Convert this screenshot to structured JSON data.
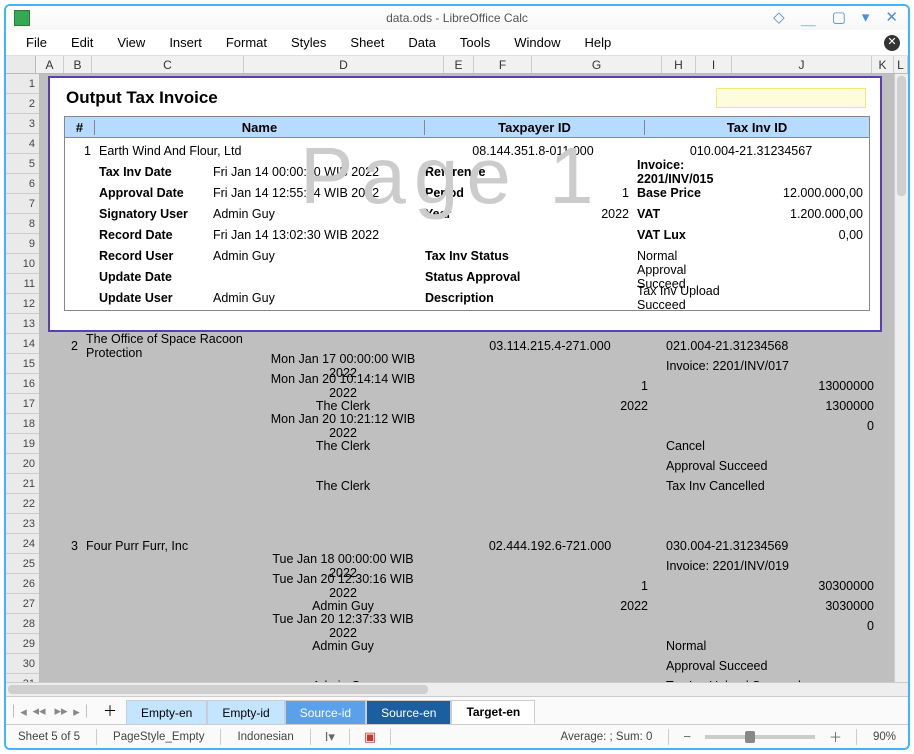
{
  "titlebar": {
    "title": "data.ods - LibreOffice Calc"
  },
  "menubar": {
    "items": [
      "File",
      "Edit",
      "View",
      "Insert",
      "Format",
      "Styles",
      "Sheet",
      "Data",
      "Tools",
      "Window",
      "Help"
    ]
  },
  "columns": [
    "A",
    "B",
    "C",
    "D",
    "E",
    "F",
    "G",
    "H",
    "I",
    "J",
    "K",
    "L"
  ],
  "row_start": 1,
  "row_end": 33,
  "watermark": "Page 1",
  "page": {
    "title": "Output Tax Invoice",
    "headers": {
      "num": "#",
      "name": "Name",
      "tpid": "Taxpayer ID",
      "inv": "Tax Inv ID"
    },
    "num": "1",
    "name": "Earth Wind And Flour, Ltd",
    "tpid": "08.144.351.8-011.000",
    "invid": "010.004-21.31234567",
    "rows": [
      {
        "label": "Tax Inv Date",
        "value": "Fri Jan 14 00:00:00 WIB 2022",
        "rlabel": "Reference",
        "rvalue": "",
        "xlabel": "Invoice: 2201/INV/015",
        "xvalue": ""
      },
      {
        "label": "Approval Date",
        "value": "Fri Jan 14 12:55:44 WIB 2022",
        "rlabel": "Period",
        "rvalue": "1",
        "xlabel": "Base Price",
        "xvalue": "12.000.000,00"
      },
      {
        "label": "Signatory User",
        "value": "Admin Guy",
        "rlabel": "Year",
        "rvalue": "2022",
        "xlabel": "VAT",
        "xvalue": "1.200.000,00"
      },
      {
        "label": "Record Date",
        "value": "Fri Jan 14 13:02:30 WIB 2022",
        "rlabel": "",
        "rvalue": "",
        "xlabel": "VAT Lux",
        "xvalue": "0,00"
      },
      {
        "label": "Record User",
        "value": "Admin Guy",
        "rlabel": "Tax Inv Status",
        "rvalue": "",
        "xlabel": "Normal",
        "xvalue": "",
        "xplain": true
      },
      {
        "label": "Update Date",
        "value": "",
        "rlabel": "Status Approval",
        "rvalue": "",
        "xlabel": "Approval Succeed",
        "xvalue": "",
        "xplain": true
      },
      {
        "label": "Update User",
        "value": "Admin Guy",
        "rlabel": "Description",
        "rvalue": "",
        "xlabel": "Tax Inv Upload Succeed",
        "xvalue": "",
        "xplain": true
      }
    ]
  },
  "below": [
    {
      "num": "2",
      "name": "The Office of Space Racoon Protection",
      "d": "",
      "tpid": "03.114.215.4-271.000",
      "inv": "021.004-21.31234568"
    },
    {
      "num": "",
      "name": "",
      "d": "Mon Jan 17 00:00:00 WIB 2022",
      "tpid": "",
      "inv": "Invoice: 2201/INV/017"
    },
    {
      "num": "",
      "name": "",
      "d": "Mon Jan 20 10:14:14 WIB 2022",
      "tpid_r": "1",
      "inv_r": "13000000"
    },
    {
      "num": "",
      "name": "",
      "d": "The Clerk",
      "tpid_r": "2022",
      "inv_r": "1300000"
    },
    {
      "num": "",
      "name": "",
      "d": "Mon Jan 20 10:21:12 WIB 2022",
      "tpid": "",
      "inv_r": "0"
    },
    {
      "num": "",
      "name": "",
      "d": "The Clerk",
      "tpid": "",
      "inv": "Cancel"
    },
    {
      "num": "",
      "name": "",
      "d": "",
      "tpid": "",
      "inv": "Approval Succeed"
    },
    {
      "num": "",
      "name": "",
      "d": "The Clerk",
      "tpid": "",
      "inv": "Tax Inv Cancelled"
    },
    {
      "spacer": true
    },
    {
      "spacer": true
    },
    {
      "num": "3",
      "name": "Four Purr Furr, Inc",
      "d": "",
      "tpid": "02.444.192.6-721.000",
      "inv": "030.004-21.31234569"
    },
    {
      "num": "",
      "name": "",
      "d": "Tue Jan 18 00:00:00 WIB 2022",
      "tpid": "",
      "inv": "Invoice: 2201/INV/019"
    },
    {
      "num": "",
      "name": "",
      "d": "Tue Jan 20 12:30:16 WIB 2022",
      "tpid_r": "1",
      "inv_r": "30300000"
    },
    {
      "num": "",
      "name": "",
      "d": "Admin Guy",
      "tpid_r": "2022",
      "inv_r": "3030000"
    },
    {
      "num": "",
      "name": "",
      "d": "Tue Jan 20 12:37:33 WIB 2022",
      "tpid": "",
      "inv_r": "0"
    },
    {
      "num": "",
      "name": "",
      "d": "Admin Guy",
      "tpid": "",
      "inv": "Normal"
    },
    {
      "num": "",
      "name": "",
      "d": "",
      "tpid": "",
      "inv": "Approval Succeed"
    },
    {
      "num": "",
      "name": "",
      "d": "Admin Guy",
      "tpid": "",
      "inv": "Tax Inv Upload Succeed"
    }
  ],
  "tabs": [
    {
      "label": "Empty-en",
      "class": "sel-light"
    },
    {
      "label": "Empty-id",
      "class": "sel-light"
    },
    {
      "label": "Source-id",
      "class": "sel-mid"
    },
    {
      "label": "Source-en",
      "class": "sel-dark"
    },
    {
      "label": "Target-en",
      "class": "active"
    }
  ],
  "statusbar": {
    "sheet": "Sheet 5 of 5",
    "pagestyle": "PageStyle_Empty",
    "lang": "Indonesian",
    "summary": "Average: ; Sum: 0",
    "zoom": "90%"
  }
}
